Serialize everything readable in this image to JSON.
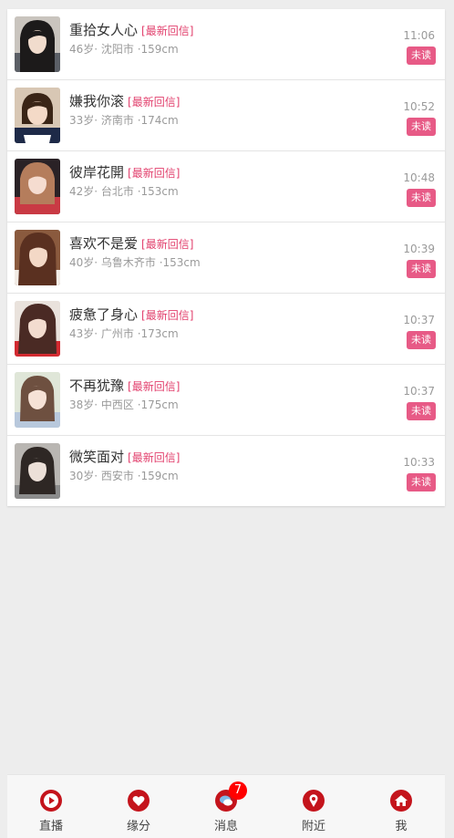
{
  "messages": [
    {
      "name": "重拾女人心",
      "tag": "[最新回信]",
      "info": "46岁· 沈阳市 ·159cm",
      "time": "11:06",
      "status": "未读"
    },
    {
      "name": "嫌我你滚",
      "tag": "[最新回信]",
      "info": "33岁· 济南市 ·174cm",
      "time": "10:52",
      "status": "未读"
    },
    {
      "name": "彼岸花開",
      "tag": "[最新回信]",
      "info": "42岁· 台北市 ·153cm",
      "time": "10:48",
      "status": "未读"
    },
    {
      "name": "喜欢不是爱",
      "tag": "[最新回信]",
      "info": "40岁· 乌鲁木齐市 ·153cm",
      "time": "10:39",
      "status": "未读"
    },
    {
      "name": "疲惫了身心",
      "tag": "[最新回信]",
      "info": "43岁· 广州市 ·173cm",
      "time": "10:37",
      "status": "未读"
    },
    {
      "name": "不再犹豫",
      "tag": "[最新回信]",
      "info": "38岁· 中西区 ·175cm",
      "time": "10:37",
      "status": "未读"
    },
    {
      "name": "微笑面对",
      "tag": "[最新回信]",
      "info": "30岁· 西安市 ·159cm",
      "time": "10:33",
      "status": "未读"
    }
  ],
  "tabs": [
    {
      "label": "直播",
      "icon": "play-icon"
    },
    {
      "label": "缘分",
      "icon": "heart-icon"
    },
    {
      "label": "消息",
      "icon": "chat-icon",
      "badge": "7"
    },
    {
      "label": "附近",
      "icon": "location-pin-icon"
    },
    {
      "label": "我",
      "icon": "home-icon"
    }
  ],
  "colors": {
    "accent": "#e2406d",
    "unread_badge": "#e75a86",
    "tab_icon": "#c4141c",
    "notify_badge": "#ff0000",
    "background": "#ededed"
  }
}
